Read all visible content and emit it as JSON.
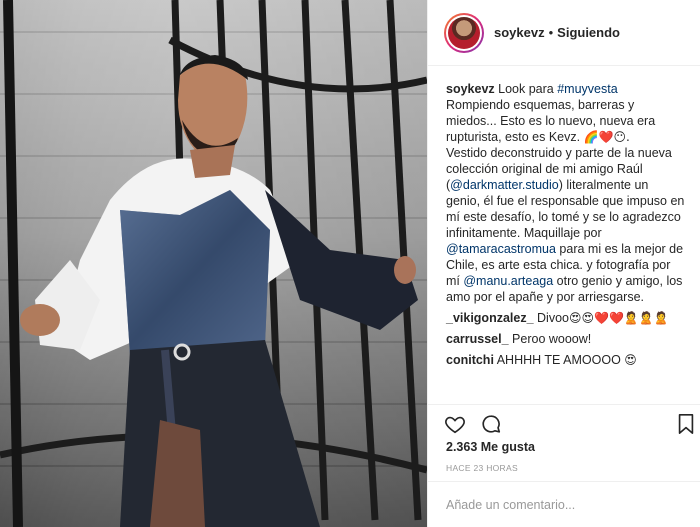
{
  "post": {
    "photo_alt": "post-photo"
  },
  "header": {
    "username": "soykevz",
    "separator": "•",
    "follow_label": "Siguiendo"
  },
  "caption": {
    "username": "soykevz",
    "hashtag": "#muyvesta",
    "line_start": "Look para ",
    "text1": "Rompiendo esquemas, barreras y miedos... Esto es lo nuevo, nueva era rupturista, esto es Kevz. ",
    "emoji1": "🌈❤️😶.",
    "text2": "Vestido deconstruido y parte de la nueva colección original de mi amigo Raúl (",
    "mention1": "@darkmatter.studio",
    "text3": ") literalmente un genio, él fue el responsable que impuso en mí este desafío, lo tomé y se lo agradezco infinitamente. Maquillaje por ",
    "mention2": "@tamaracastromua",
    "text4": " para mi es la mejor de Chile, es arte esta chica. y fotografía por mí ",
    "mention3": "@manu.arteaga",
    "text5": " otro genio y amigo, los amo por el apañe y por arriesgarse."
  },
  "comments": [
    {
      "username": "_vikigonzalez_",
      "text": " Divoo",
      "emoji": "😍😍❤️❤️🙎🙎🙎"
    },
    {
      "username": "carrussel_",
      "text": " Peroo wooow!",
      "emoji": ""
    },
    {
      "username": "conitchi",
      "text": " AHHHH TE AMOOOO ",
      "emoji": "😍"
    },
    {
      "username": "",
      "text": "",
      "emoji": "",
      "cut": "                 "
    }
  ],
  "actions": {
    "like_icon": "heart-outline-icon",
    "comment_icon": "comment-bubble-icon",
    "save_icon": "bookmark-icon"
  },
  "likes_label": "2.363 Me gusta",
  "timestamp": "HACE 23 HORAS",
  "comment_input": {
    "placeholder": "Añade un comentario...",
    "value": ""
  },
  "colors": {
    "link": "#003569",
    "text": "#262626",
    "muted": "#999999",
    "border": "#efefef"
  }
}
